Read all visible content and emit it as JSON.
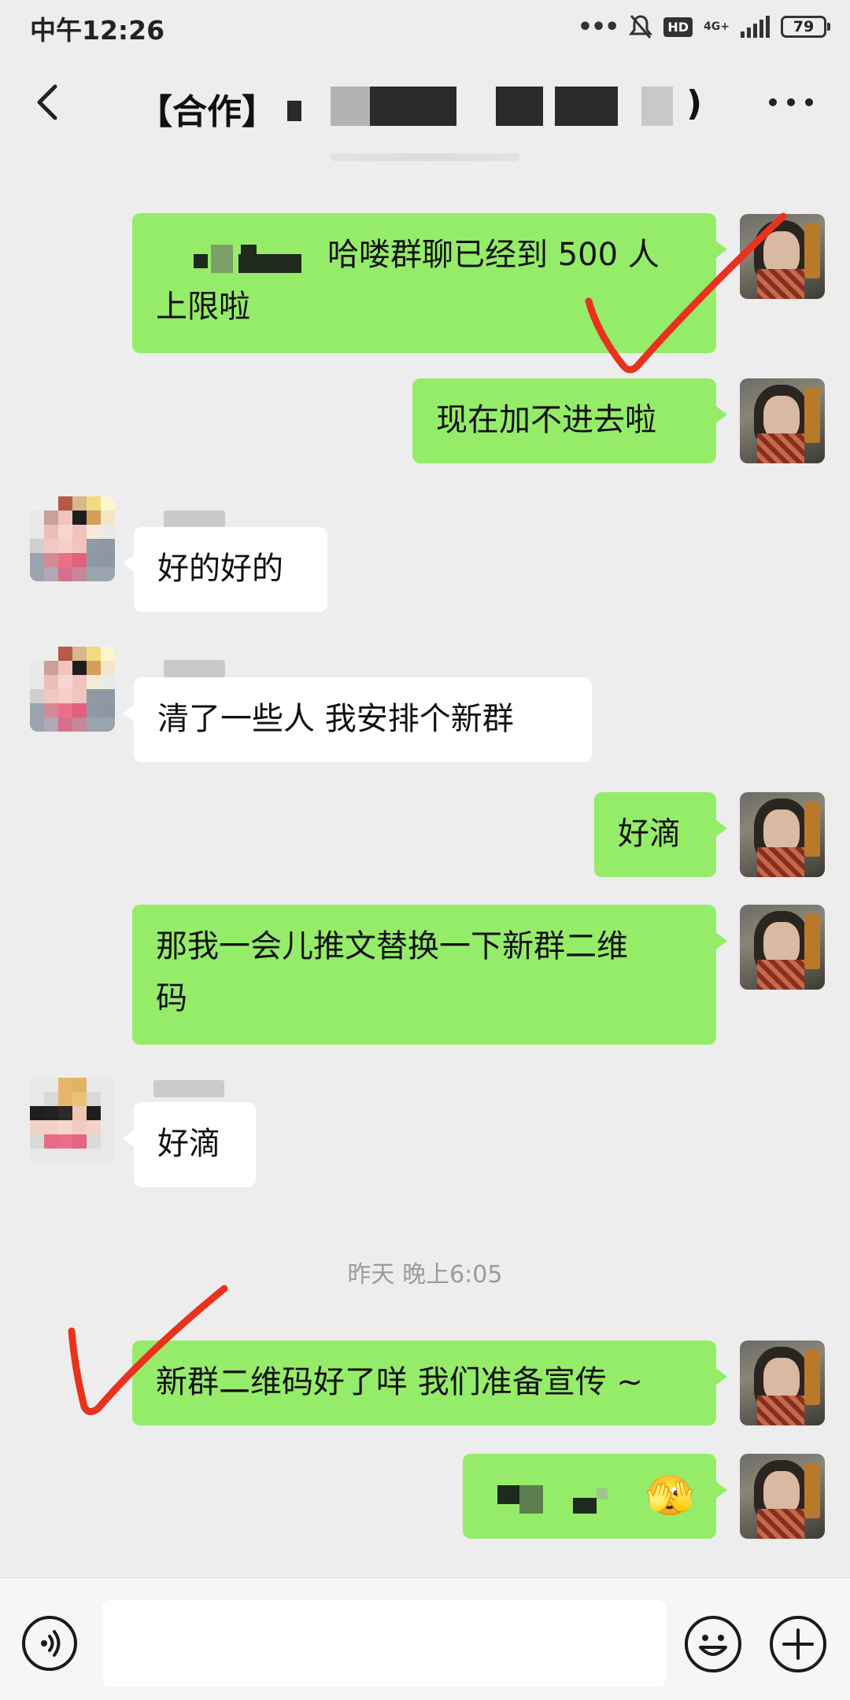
{
  "status_bar": {
    "time": "中午12:26",
    "network": "4G+",
    "hd": "HD",
    "battery": "79"
  },
  "header": {
    "title_prefix": "【合作】",
    "title_suffix": ")"
  },
  "messages": [
    {
      "from": "me",
      "text": "哈喽群聊已经到 500 人",
      "text2": "上限啦"
    },
    {
      "from": "me",
      "text": "现在加不进去啦"
    },
    {
      "from": "them",
      "text": "好的好的"
    },
    {
      "from": "them",
      "text": "清了一些人 我安排个新群"
    },
    {
      "from": "me",
      "text": "好滴"
    },
    {
      "from": "me",
      "text": "那我一会儿推文替换一下新群二维",
      "text2": "码"
    },
    {
      "from": "them",
      "text": "好滴"
    },
    {
      "from": "me",
      "text": "新群二维码好了咩 我们准备宣传 ~"
    },
    {
      "from": "me",
      "text": "🫣"
    }
  ],
  "timestamp": "昨天 晚上6:05",
  "icons": {
    "back": "chevron-left-icon",
    "more": "more-dots-icon",
    "voice": "voice-icon",
    "emoji": "emoji-icon",
    "plus": "plus-icon"
  },
  "colors": {
    "my_bubble": "#95ec69",
    "their_bubble": "#ffffff",
    "background": "#ededed",
    "annotation": "#e8321e"
  }
}
